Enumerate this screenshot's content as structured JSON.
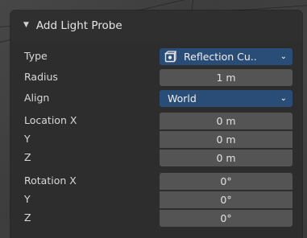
{
  "panel": {
    "title": "Add Light Probe",
    "collapse_glyph": "▼"
  },
  "fields": {
    "type": {
      "label": "Type",
      "value": "Reflection Cu..",
      "icon": "reflection-cubemap-icon"
    },
    "radius": {
      "label": "Radius",
      "value": "1 m"
    },
    "align": {
      "label": "Align",
      "value": "World"
    },
    "location": {
      "label_x": "Location X",
      "label_y": "Y",
      "label_z": "Z",
      "x": "0 m",
      "y": "0 m",
      "z": "0 m"
    },
    "rotation": {
      "label_x": "Rotation X",
      "label_y": "Y",
      "label_z": "Z",
      "x": "0°",
      "y": "0°",
      "z": "0°"
    }
  },
  "chevron_glyph": "⌄",
  "colors": {
    "dropdown_bg": "#2a4d77",
    "field_bg": "#545454",
    "panel_bg": "#2d2d2d"
  }
}
